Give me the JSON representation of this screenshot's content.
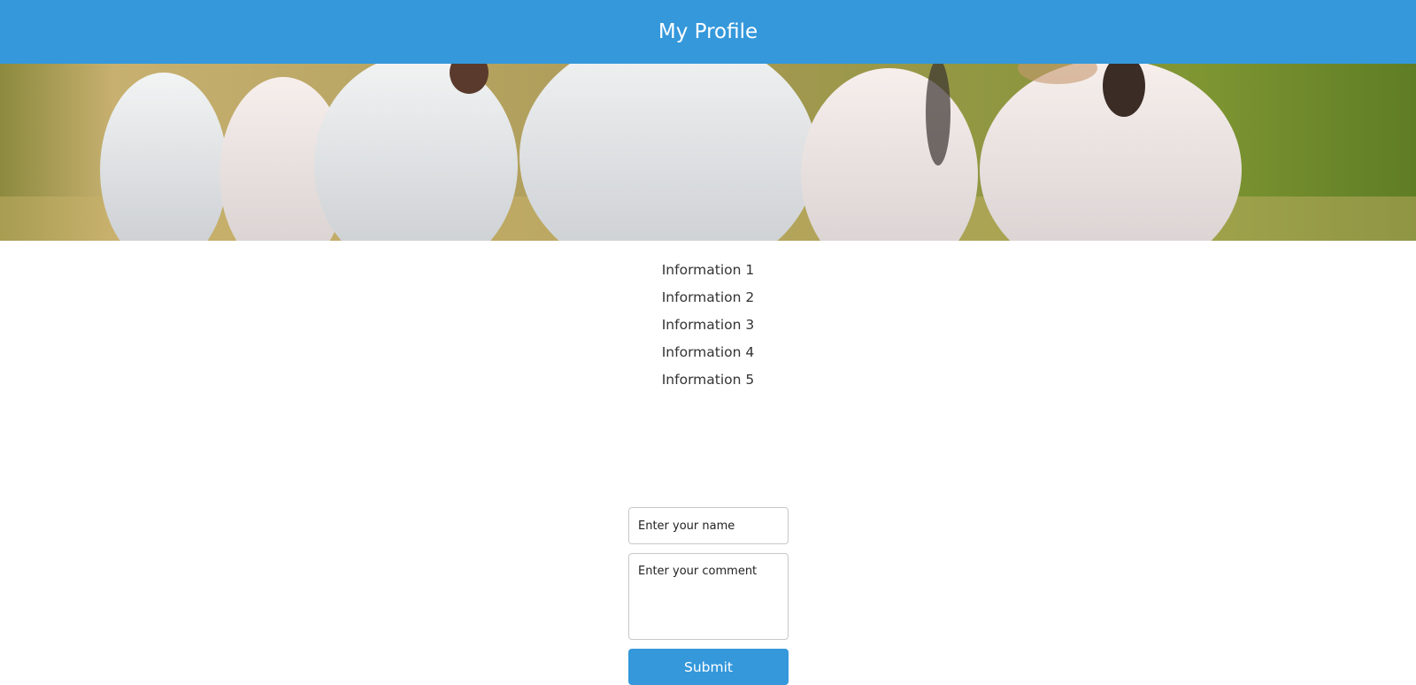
{
  "header": {
    "title": "My Profile"
  },
  "banner": {
    "image_subject": "white horses running in a field",
    "colors": {
      "brand": "#3498db"
    }
  },
  "info": {
    "items": [
      "Information 1",
      "Information 2",
      "Information 3",
      "Information 4",
      "Information 5"
    ]
  },
  "form": {
    "name_placeholder": "Enter your name",
    "comment_placeholder": "Enter your comment",
    "submit_label": "Submit"
  }
}
